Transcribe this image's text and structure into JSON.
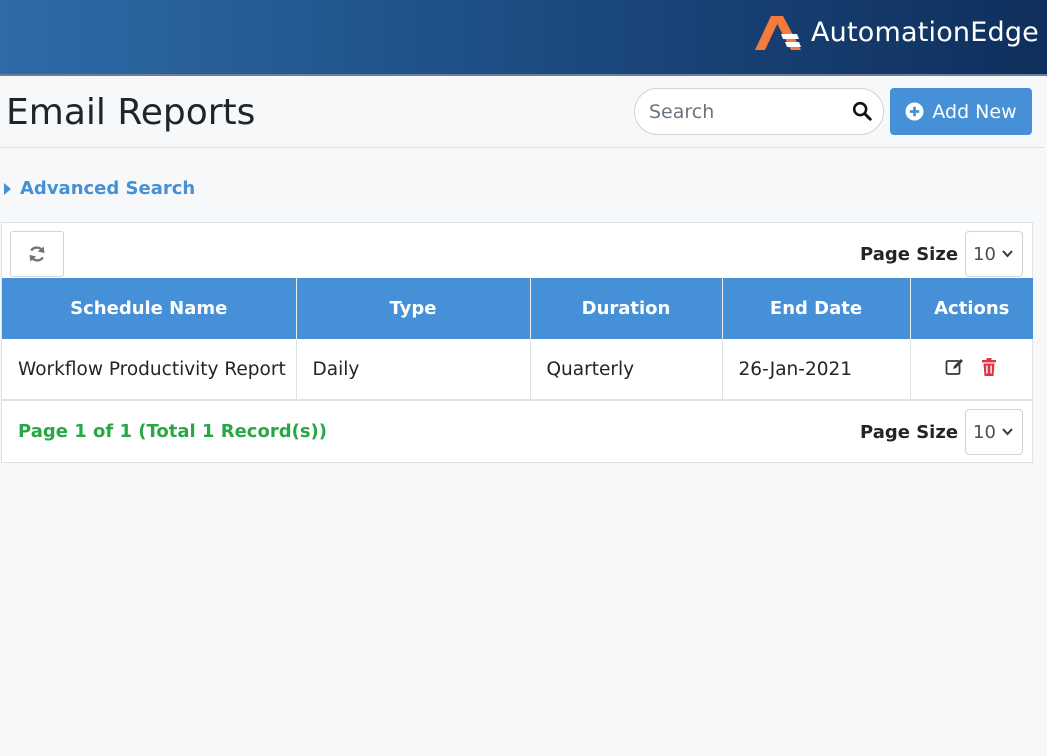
{
  "brand": {
    "name": "AutomationEdge",
    "accent": "#f47b3b"
  },
  "header": {
    "title": "Email Reports"
  },
  "search": {
    "placeholder": "Search",
    "icon": "search-icon"
  },
  "add_button": {
    "label": "Add New",
    "icon": "plus-circle-icon"
  },
  "advanced_search": {
    "label": "Advanced Search"
  },
  "toolbar": {
    "refresh_icon": "refresh-icon",
    "page_size_label": "Page Size",
    "page_size_value": "10"
  },
  "table": {
    "columns": [
      "Schedule Name",
      "Type",
      "Duration",
      "End Date",
      "Actions"
    ],
    "rows": [
      {
        "schedule_name": "Workflow Productivity Report",
        "type": "Daily",
        "duration": "Quarterly",
        "end_date": "26-Jan-2021"
      }
    ]
  },
  "footer": {
    "page_info": "Page 1 of 1 (Total 1 Record(s))",
    "page_size_label": "Page Size",
    "page_size_value": "10"
  },
  "colors": {
    "primary": "#4590d6",
    "success": "#28a745",
    "danger": "#dc3545"
  }
}
